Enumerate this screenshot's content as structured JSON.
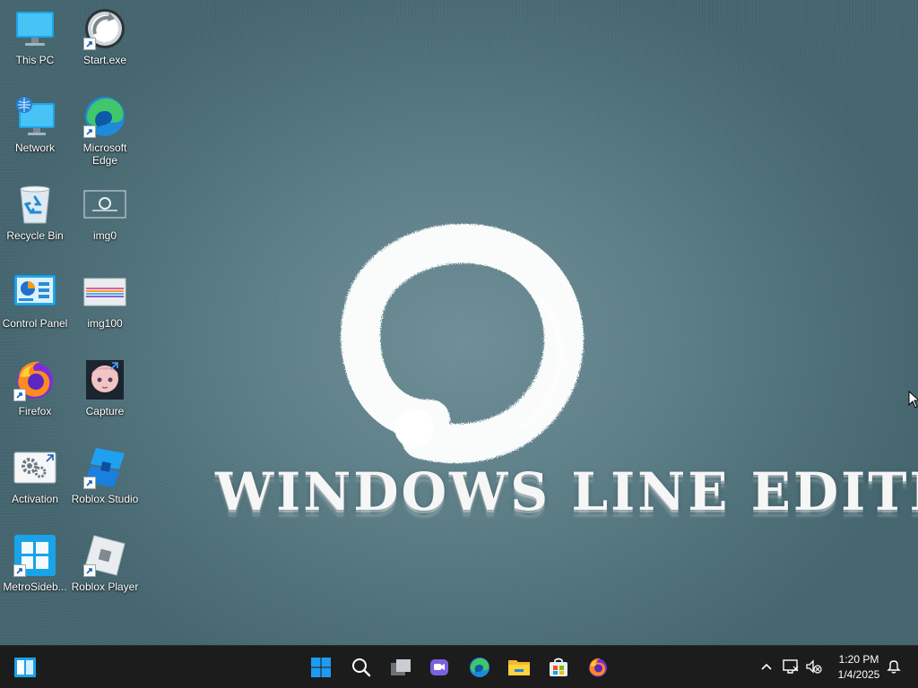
{
  "wallpaper": {
    "title": "WINDOWS LINE EDITION"
  },
  "desktop_icons": [
    {
      "label": "This PC",
      "icon": "this-pc-icon",
      "shortcut": false
    },
    {
      "label": "Start.exe",
      "icon": "start-exe-icon",
      "shortcut": true
    },
    {
      "label": "Network",
      "icon": "network-icon",
      "shortcut": false
    },
    {
      "label": "Microsoft Edge",
      "icon": "edge-icon",
      "shortcut": true
    },
    {
      "label": "Recycle Bin",
      "icon": "recycle-bin-icon",
      "shortcut": false
    },
    {
      "label": "img0",
      "icon": "image-file-icon",
      "shortcut": false
    },
    {
      "label": "Control Panel",
      "icon": "control-panel-icon",
      "shortcut": false
    },
    {
      "label": "img100",
      "icon": "image-file-icon",
      "shortcut": false
    },
    {
      "label": "Firefox",
      "icon": "firefox-icon",
      "shortcut": true
    },
    {
      "label": "Capture",
      "icon": "capture-image-icon",
      "shortcut": false
    },
    {
      "label": "Activation",
      "icon": "activation-gears-icon",
      "shortcut": false
    },
    {
      "label": "Roblox Studio",
      "icon": "roblox-studio-icon",
      "shortcut": true
    },
    {
      "label": "MetroSideb...",
      "icon": "metro-sidebar-icon",
      "shortcut": true
    },
    {
      "label": "Roblox Player",
      "icon": "roblox-player-icon",
      "shortcut": true
    }
  ],
  "taskbar": {
    "left_app": "metro-sidebar-icon",
    "pinned": [
      {
        "name": "start",
        "icon": "windows-start-icon"
      },
      {
        "name": "search",
        "icon": "search-icon"
      },
      {
        "name": "task-view",
        "icon": "task-view-icon"
      },
      {
        "name": "chat",
        "icon": "chat-icon"
      },
      {
        "name": "edge",
        "icon": "edge-icon"
      },
      {
        "name": "file-explorer",
        "icon": "folder-icon"
      },
      {
        "name": "store",
        "icon": "store-icon"
      },
      {
        "name": "firefox",
        "icon": "firefox-icon"
      }
    ],
    "tray": {
      "overflow": "chevron-up-icon",
      "network": "network-monitor-icon",
      "volume": "volume-muted-icon",
      "notifications": "notification-icon"
    },
    "clock": {
      "time": "1:20 PM",
      "date": "1/4/2025"
    }
  },
  "colors": {
    "accent": "#0a8ad6",
    "taskbar_bg": "#1c1c1c",
    "wallpaper_center": "#6e8f98",
    "wallpaper_edge": "#456670"
  }
}
